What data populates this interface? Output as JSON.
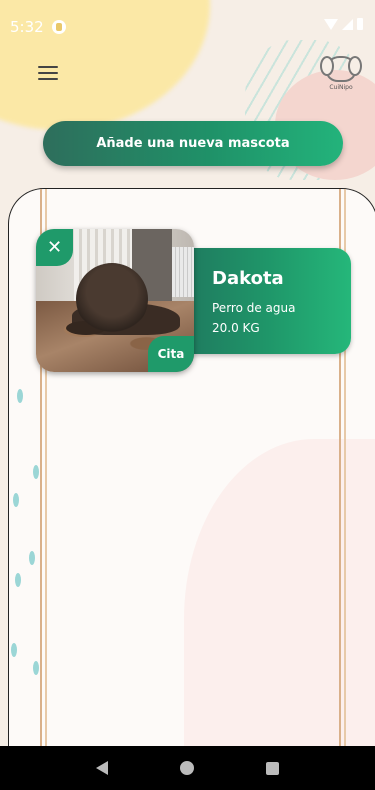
{
  "status_bar": {
    "time": "5:32"
  },
  "app_bar": {
    "logo_text": "CuiNipo"
  },
  "actions": {
    "add_pet_label": "Añade una nueva mascota"
  },
  "pets": [
    {
      "name": "Dakota",
      "breed": "Perro de agua",
      "weight": "20.0 KG",
      "close_label": "✕",
      "appointment_label": "Cita"
    }
  ],
  "colors": {
    "accent_green": "#1f9669",
    "background": "#f6eee6"
  }
}
